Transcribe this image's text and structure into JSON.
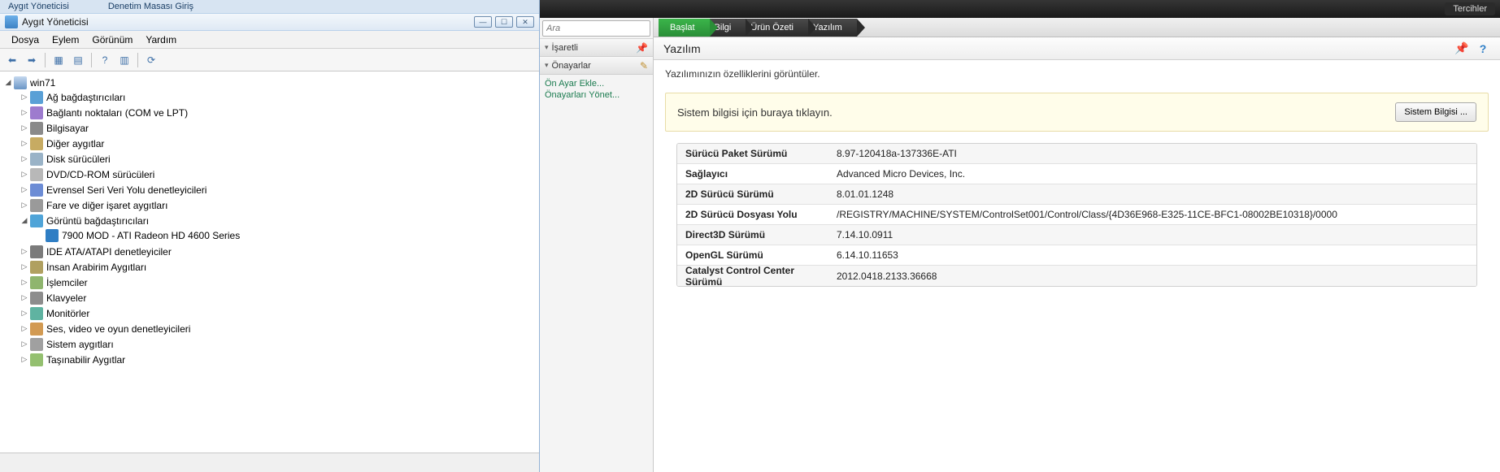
{
  "devmgr": {
    "bg_tab_1": "Aygıt Yöneticisi",
    "bg_tab_2": "Denetim Masası Giriş",
    "window_title": "Aygıt Yöneticisi",
    "menu": {
      "file": "Dosya",
      "action": "Eylem",
      "view": "Görünüm",
      "help": "Yardım"
    },
    "root": "win71",
    "nodes": [
      {
        "label": "Ağ bağdaştırıcıları",
        "ico": "net"
      },
      {
        "label": "Bağlantı noktaları (COM ve LPT)",
        "ico": "port"
      },
      {
        "label": "Bilgisayar",
        "ico": "comp"
      },
      {
        "label": "Diğer aygıtlar",
        "ico": "other"
      },
      {
        "label": "Disk sürücüleri",
        "ico": "disk"
      },
      {
        "label": "DVD/CD-ROM sürücüleri",
        "ico": "dvd"
      },
      {
        "label": "Evrensel Seri Veri Yolu denetleyicileri",
        "ico": "usb"
      },
      {
        "label": "Fare ve diğer işaret aygıtları",
        "ico": "mouse"
      },
      {
        "label": "Görüntü bağdaştırıcıları",
        "ico": "disp",
        "expanded": true,
        "children": [
          {
            "label": "7900 MOD - ATI Radeon HD 4600 Series",
            "ico": "gpu"
          }
        ]
      },
      {
        "label": "IDE ATA/ATAPI denetleyiciler",
        "ico": "ide"
      },
      {
        "label": "İnsan Arabirim Aygıtları",
        "ico": "hid"
      },
      {
        "label": "İşlemciler",
        "ico": "cpu"
      },
      {
        "label": "Klavyeler",
        "ico": "kb"
      },
      {
        "label": "Monitörler",
        "ico": "mon"
      },
      {
        "label": "Ses, video ve oyun denetleyicileri",
        "ico": "snd"
      },
      {
        "label": "Sistem aygıtları",
        "ico": "sys"
      },
      {
        "label": "Taşınabilir Aygıtlar",
        "ico": "mob"
      }
    ]
  },
  "ccc": {
    "top_right": "Tercihler",
    "search_placeholder": "Ara",
    "acc_pinned": "İşaretli",
    "acc_presets": "Önayarlar",
    "link_add": "Ön Ayar Ekle...",
    "link_manage": "Önayarları Yönet...",
    "tabs": {
      "t0": "Başlat",
      "t1": "Bilgi",
      "t2": "Ürün Özeti",
      "t3": "Yazılım"
    },
    "page_title": "Yazılım",
    "page_desc": "Yazılımınızın özelliklerini görüntüler.",
    "banner_text": "Sistem bilgisi için buraya tıklayın.",
    "banner_button": "Sistem Bilgisi ...",
    "rows": [
      {
        "k": "Sürücü Paket Sürümü",
        "v": "8.97-120418a-137336E-ATI"
      },
      {
        "k": "Sağlayıcı",
        "v": "Advanced Micro Devices, Inc."
      },
      {
        "k": "2D Sürücü Sürümü",
        "v": "8.01.01.1248"
      },
      {
        "k": "2D Sürücü Dosyası Yolu",
        "v": "/REGISTRY/MACHINE/SYSTEM/ControlSet001/Control/Class/{4D36E968-E325-11CE-BFC1-08002BE10318}/0000"
      },
      {
        "k": "Direct3D Sürümü",
        "v": "7.14.10.0911"
      },
      {
        "k": "OpenGL Sürümü",
        "v": "6.14.10.11653"
      },
      {
        "k": "Catalyst Control Center Sürümü",
        "v": "2012.0418.2133.36668"
      }
    ]
  }
}
